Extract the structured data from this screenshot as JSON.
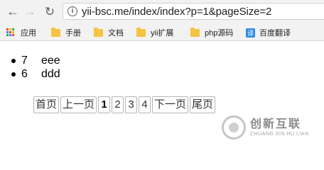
{
  "browser": {
    "url": "yii-bsc.me/index/index?p=1&pageSize=2",
    "back_glyph": "←",
    "forward_glyph": "→",
    "reload_glyph": "↻",
    "info_glyph": "i"
  },
  "bookmarks": [
    {
      "label": "应用",
      "icon": "apps-icon"
    },
    {
      "label": "手册",
      "icon": "folder-icon"
    },
    {
      "label": "文档",
      "icon": "folder-icon"
    },
    {
      "label": "yii扩展",
      "icon": "folder-icon"
    },
    {
      "label": "php源码",
      "icon": "folder-icon"
    },
    {
      "label": "百度翻译",
      "icon": "fanyi-icon",
      "icon_text": "译"
    }
  ],
  "list": [
    {
      "id": "7",
      "name": "eee"
    },
    {
      "id": "6",
      "name": "ddd"
    }
  ],
  "pager": {
    "first": "首页",
    "prev": "上一页",
    "pages": [
      "1",
      "2",
      "3",
      "4"
    ],
    "current": "1",
    "next": "下一页",
    "last": "尾页"
  },
  "watermark": {
    "cn": "创新互联",
    "en": "CHUANG XIN HU LIAN"
  },
  "colors": {
    "apps_icon": [
      "#ea4335",
      "#fbbc05",
      "#34a853",
      "#4285f4",
      "#ea4335",
      "#fbbc05",
      "#34a853",
      "#4285f4",
      "#ea4335"
    ],
    "folder": "#f6c342",
    "fanyi": "#2e8ae6"
  }
}
